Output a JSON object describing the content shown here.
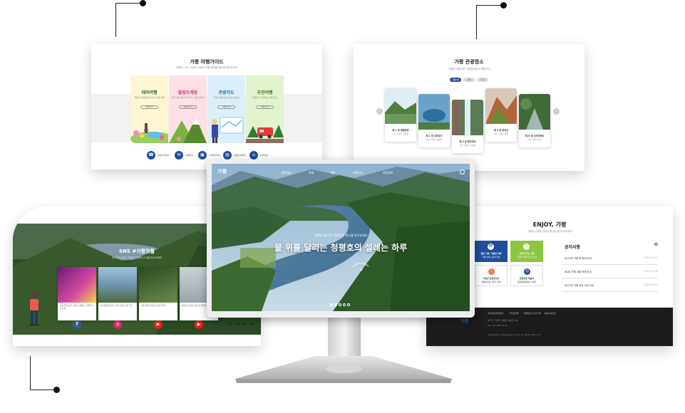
{
  "guide": {
    "title": "가평 여행가이드",
    "subtitle": "여행의 시작, 가평의 다양한 여행 정보를 한눈에 확인하세요",
    "columns": [
      {
        "title": "테마여행",
        "desc": "계절과 테마별로 즐기는 가평 여행",
        "btn": "자세히보기",
        "bg": "#fcf6d3",
        "color": "#2e6b2f"
      },
      {
        "title": "힐링트레킹",
        "desc": "자연 속을 걸으며 즐기는 힐링 트레킹",
        "btn": "자세히보기",
        "bg": "#fde1e6",
        "color": "#d6356e"
      },
      {
        "title": "관광지도",
        "desc": "가평 관광지를 지도로 한눈에",
        "btn": "자세히보기",
        "bg": "#dcf0f9",
        "color": "#1e6fa8"
      },
      {
        "title": "추천여행",
        "desc": "가평에서 추천하는 여행 코스",
        "btn": "자세히보기",
        "bg": "#e3f3cf",
        "color": "#3d7a1f"
      }
    ],
    "icons": [
      {
        "icon": "phone-icon",
        "label": "관광안내센터"
      },
      {
        "icon": "chat-icon",
        "label": "여행상담"
      },
      {
        "icon": "bus-icon",
        "label": "시티투어버스"
      },
      {
        "icon": "document-icon",
        "label": "관광안내책자"
      },
      {
        "icon": "building-icon",
        "label": "숙박정보"
      }
    ]
  },
  "tour": {
    "title": "가평 관광명소",
    "subtitle": "가평의 아름다운 관광명소를 소개합니다",
    "filters": [
      "가평8경",
      "전체",
      "추천"
    ],
    "items": [
      {
        "name": "제 1 경 청평호반",
        "addr": "경기 가평군 청평면",
        "bg": "#7aa86a"
      },
      {
        "name": "제 2 경 호명호수",
        "addr": "경기 가평군 청평면",
        "bg": "#5f95b5"
      },
      {
        "name": "제 3 경 용추계곡",
        "addr": "경기 가평군 가평읍",
        "bg": "#6e8c6a"
      },
      {
        "name": "제 4 경 명지산",
        "addr": "경기 가평군 북면",
        "bg": "#b5643a"
      },
      {
        "name": "제 5 경 도마치계곡",
        "addr": "경기 가평군 북면",
        "bg": "#4f7d4a"
      }
    ]
  },
  "sns": {
    "title": "SNS #가평맛플",
    "subtitle": "공식 SNS에서 가평의 다양한 소식을 만나보세요",
    "posts": [
      {
        "caption": "가평 쁘띠프랑스 야경과 함께하는 특별한 겨울 축제",
        "bg": "#7a2f8c",
        "network": "facebook",
        "badge": "f",
        "badge_color": "#3b5998"
      },
      {
        "caption": "자라섬에서 즐기는 가족 나들이 추천 코스",
        "bg": "#6b8fa8",
        "network": "instagram",
        "badge": "◎",
        "badge_color": "#d6296f"
      },
      {
        "caption": "가평 잣향기 푸른숲 힐링 산책로",
        "bg": "#4e6a3a",
        "network": "youtube",
        "badge": "▶",
        "badge_color": "#e62117"
      },
      {
        "caption": "아침고요수목원 겨울 빛 축제 현장",
        "bg": "#9aa4a8",
        "network": "youtube",
        "badge": "▶",
        "badge_color": "#e62117"
      }
    ]
  },
  "enjoy": {
    "title": "ENJOY, 가평",
    "subtitle": "가평의 다양한 서비스를 한눈에 만나보세요",
    "tiles": [
      {
        "label": "열린 가평, 저렴한 여행",
        "sub": "가평 숙박, 음식 정보",
        "bg": "#1f4e9c",
        "color": "#fff"
      },
      {
        "label": "자전거 타는 가평",
        "sub": "자전거 여행 코스 안내",
        "bg": "#8cc63f",
        "color": "#fff"
      },
      {
        "label": "가평군 관광안내소",
        "sub": "관광안내소 위치 안내",
        "bg": "#ffffff",
        "color": "#333"
      },
      {
        "label": "문화관광 해설사",
        "sub": "문화관광해설사 예약",
        "bg": "#ffffff",
        "color": "#333"
      }
    ],
    "notice": {
      "title": "공지사항",
      "plus": "+",
      "rows": [
        {
          "text": "2025년 가평 봄 축제 안내",
          "date": "2025.01.10"
        },
        {
          "text": "제1회 가평 겨울 축제 안내",
          "date": "2025.01.08"
        },
        {
          "text": "2025년 가평 관광 사업 안내",
          "date": "2025.01.05"
        }
      ]
    },
    "footer": {
      "links": [
        "개인정보처리방침",
        "저작권정책",
        "이메일무단수집거부",
        "뷰어다운로드"
      ],
      "address": "경기도 가평군 가평읍 석봉로 181",
      "tel": "Tel. 031-580-2114",
      "copyright": "copyright(c) gapyeong county. all rights reserved."
    }
  },
  "monitor": {
    "logo": "가평",
    "nav": [
      "관광명소",
      "축제",
      "체험",
      "여행코스",
      "관광정보"
    ],
    "hero_sub": "가평을 대표하는 아름다운 명소를 만나보세요",
    "hero_title": "물 위를 달리는 청평호의 설레는 하루"
  }
}
